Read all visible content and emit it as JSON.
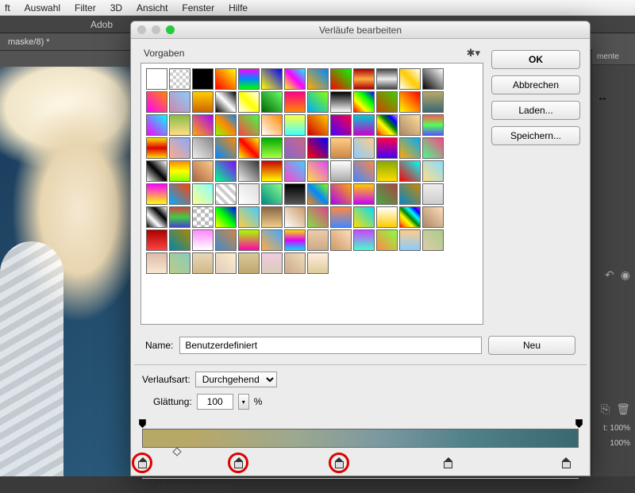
{
  "menubar": [
    "ft",
    "Auswahl",
    "Filter",
    "3D",
    "Ansicht",
    "Fenster",
    "Hilfe"
  ],
  "app_title_fragment": "Adob",
  "doc_tab": "maske/8) *",
  "right_panel_tab": "mente",
  "right_values": [
    "t:",
    "100%",
    "100%"
  ],
  "dialog": {
    "title": "Verläufe bearbeiten",
    "presets_label": "Vorgaben",
    "buttons": {
      "ok": "OK",
      "cancel": "Abbrechen",
      "load": "Laden...",
      "save": "Speichern...",
      "new": "Neu"
    },
    "name_label": "Name:",
    "name_value": "Benutzerdefiniert",
    "type_label": "Verlaufsart:",
    "type_value": "Durchgehend",
    "smooth_label": "Glättung:",
    "smooth_value": "100",
    "smooth_unit": "%",
    "breaks_label": "Unterbrechungen"
  },
  "presets": [
    "linear-gradient(#fff,#fff)",
    "repeating-conic-gradient(#ccc 0 25%,#fff 0 50%) 0/8px 8px",
    "linear-gradient(#000,#000)",
    "linear-gradient(45deg,#f00,#ff0)",
    "linear-gradient(#f0f,#08f,#0f0)",
    "linear-gradient(45deg,#ff0,#00f)",
    "linear-gradient(45deg,#ff0,#f0f,#0ff)",
    "linear-gradient(45deg,#fa0,#08f)",
    "linear-gradient(45deg,#f00,#0f0)",
    "linear-gradient(#a00,#fa4,#a00)",
    "linear-gradient(#444,#eee,#444)",
    "linear-gradient(45deg,#fff,#fc0,#fff)",
    "linear-gradient(45deg,#000,#fff)",
    "linear-gradient(45deg,#f0f,#f80)",
    "linear-gradient(45deg,#c8a,#8cf)",
    "linear-gradient(#fc0,#c60)",
    "linear-gradient(45deg,#000,#fff,#000)",
    "linear-gradient(45deg,#fff,#ff0,#fff)",
    "linear-gradient(45deg,#060,#6f6)",
    "linear-gradient(#f08,#f80)",
    "linear-gradient(45deg,#0af,#8f0)",
    "linear-gradient(#000,#fff)",
    "linear-gradient(45deg,#f00,#ff0,#0f0,#00f)",
    "linear-gradient(45deg,#c40,#4c0)",
    "linear-gradient(45deg,#ff0,#f00)",
    "linear-gradient(#b8a868,#3a6872)",
    "linear-gradient(45deg,#f0f,#0ff)",
    "linear-gradient(#8b4,#fd8)",
    "linear-gradient(45deg,#fa0,#a0f)",
    "linear-gradient(45deg,#8f0,#f80,#08f)",
    "linear-gradient(45deg,#f44,#4f4)",
    "linear-gradient(45deg,#fff,#f80)",
    "linear-gradient(#ff4,#4ff)",
    "linear-gradient(45deg,#c00,#fc0)",
    "linear-gradient(45deg,#40f,#f04)",
    "linear-gradient(#0cc,#c0c)",
    "linear-gradient(45deg,red,orange,yellow,green,blue,violet)",
    "linear-gradient(45deg,#a86,#fd9)",
    "linear-gradient(#f55,#5f5,#55f)",
    "linear-gradient(#fd0,#d00,#fd0)",
    "linear-gradient(45deg,#fa8,#8af)",
    "linear-gradient(45deg,#eee,#888)",
    "linear-gradient(45deg,#08f,#f80)",
    "linear-gradient(45deg,#ff0,#f00,#ff0)",
    "linear-gradient(#0a0,#af4)",
    "linear-gradient(45deg,#86c,#c68)",
    "linear-gradient(45deg,#f00,#00f)",
    "linear-gradient(#fc8,#c84)",
    "linear-gradient(45deg,#8cf,#fc8)",
    "linear-gradient(#f04,#40f)",
    "linear-gradient(45deg,#fa0,#0af)",
    "linear-gradient(45deg,#4f8,#f48)",
    "linear-gradient(45deg,#fff,#000,#fff)",
    "linear-gradient(#f80,#ff0,#8f0)",
    "linear-gradient(45deg,#a64,#fc8)",
    "linear-gradient(45deg,#0f8,#80f)",
    "linear-gradient(45deg,#eee,#333)",
    "linear-gradient(#c00,#ff0)",
    "linear-gradient(45deg,#f4c,#4cf)",
    "linear-gradient(45deg,#fd4,#d4f)",
    "linear-gradient(#fff,#aaa)",
    "linear-gradient(45deg,#48f,#f84)",
    "linear-gradient(#8a0,#fd0)",
    "linear-gradient(45deg,#f00,#0ff)",
    "linear-gradient(45deg,#fd8,#8df)",
    "linear-gradient(#f0f,#ff0)",
    "linear-gradient(45deg,#0af,#f40)",
    "linear-gradient(45deg,#ff8,#8ff)",
    "repeating-linear-gradient(45deg,#ccc 0 4px,#fff 4px 8px)",
    "linear-gradient(45deg,#fff,#ddd)",
    "linear-gradient(45deg,#088,#8f8)",
    "linear-gradient(#000,#555)",
    "linear-gradient(45deg,#f80,#08f,#8f0)",
    "linear-gradient(45deg,#a0f,#fa0)",
    "linear-gradient(#fc0,#c0f)",
    "linear-gradient(45deg,#4a4,#a44)",
    "linear-gradient(45deg,#08c,#c80)",
    "linear-gradient(#eee,#ccc)",
    "linear-gradient(45deg,#000,#fff,#000,#fff)",
    "linear-gradient(#c44,#4c4,#44c)",
    "repeating-conic-gradient(#bbb 0 25%,#fff 0 50%) 0/10px 10px",
    "linear-gradient(45deg,#ff0,#0f0,#00f)",
    "linear-gradient(45deg,#fc4,#4cf)",
    "linear-gradient(#864,#ec8)",
    "linear-gradient(45deg,#fff,#c96)",
    "linear-gradient(45deg,#8d4,#d48)",
    "linear-gradient(#f84,#48f)",
    "linear-gradient(45deg,#fd0,#0df)",
    "linear-gradient(#fff,#fc0)",
    "linear-gradient(45deg,red,orange,yellow,green,cyan,blue,magenta)",
    "linear-gradient(45deg,#a86,#fdb)",
    "linear-gradient(#a00,#f44)",
    "linear-gradient(45deg,#08a,#a80)",
    "linear-gradient(#f8f,#fff)",
    "linear-gradient(45deg,#48c,#c84)",
    "linear-gradient(#af0,#f0a)",
    "linear-gradient(45deg,#fa4,#4af)",
    "linear-gradient(#fd0,#d0f,#0df)",
    "linear-gradient(#eca,#ca8)",
    "linear-gradient(45deg,#c96,#fdb)",
    "linear-gradient(#c4f,#4fc)",
    "linear-gradient(45deg,#f84,#8f4)",
    "linear-gradient(#fc8,#8cf)",
    "linear-gradient(45deg,#dca,#ac8)",
    "linear-gradient(#dba,#f8e8d0)",
    "linear-gradient(45deg,#bc8,#8cb)",
    "linear-gradient(#e8d8b8,#d0b888)",
    "linear-gradient(45deg,#dcb,#fec)",
    "linear-gradient(#d8c898,#c0a870)",
    "linear-gradient(#ecd,#dcb)",
    "linear-gradient(45deg,#ca8,#edb)",
    "linear-gradient(#fed,#dc9)"
  ],
  "opacity_stops_pct": [
    0,
    100
  ],
  "midpoints_pct": [
    8
  ],
  "color_stops_pct": [
    0,
    22,
    45,
    70,
    97
  ],
  "circled_stops_idx": [
    0,
    1,
    2
  ]
}
